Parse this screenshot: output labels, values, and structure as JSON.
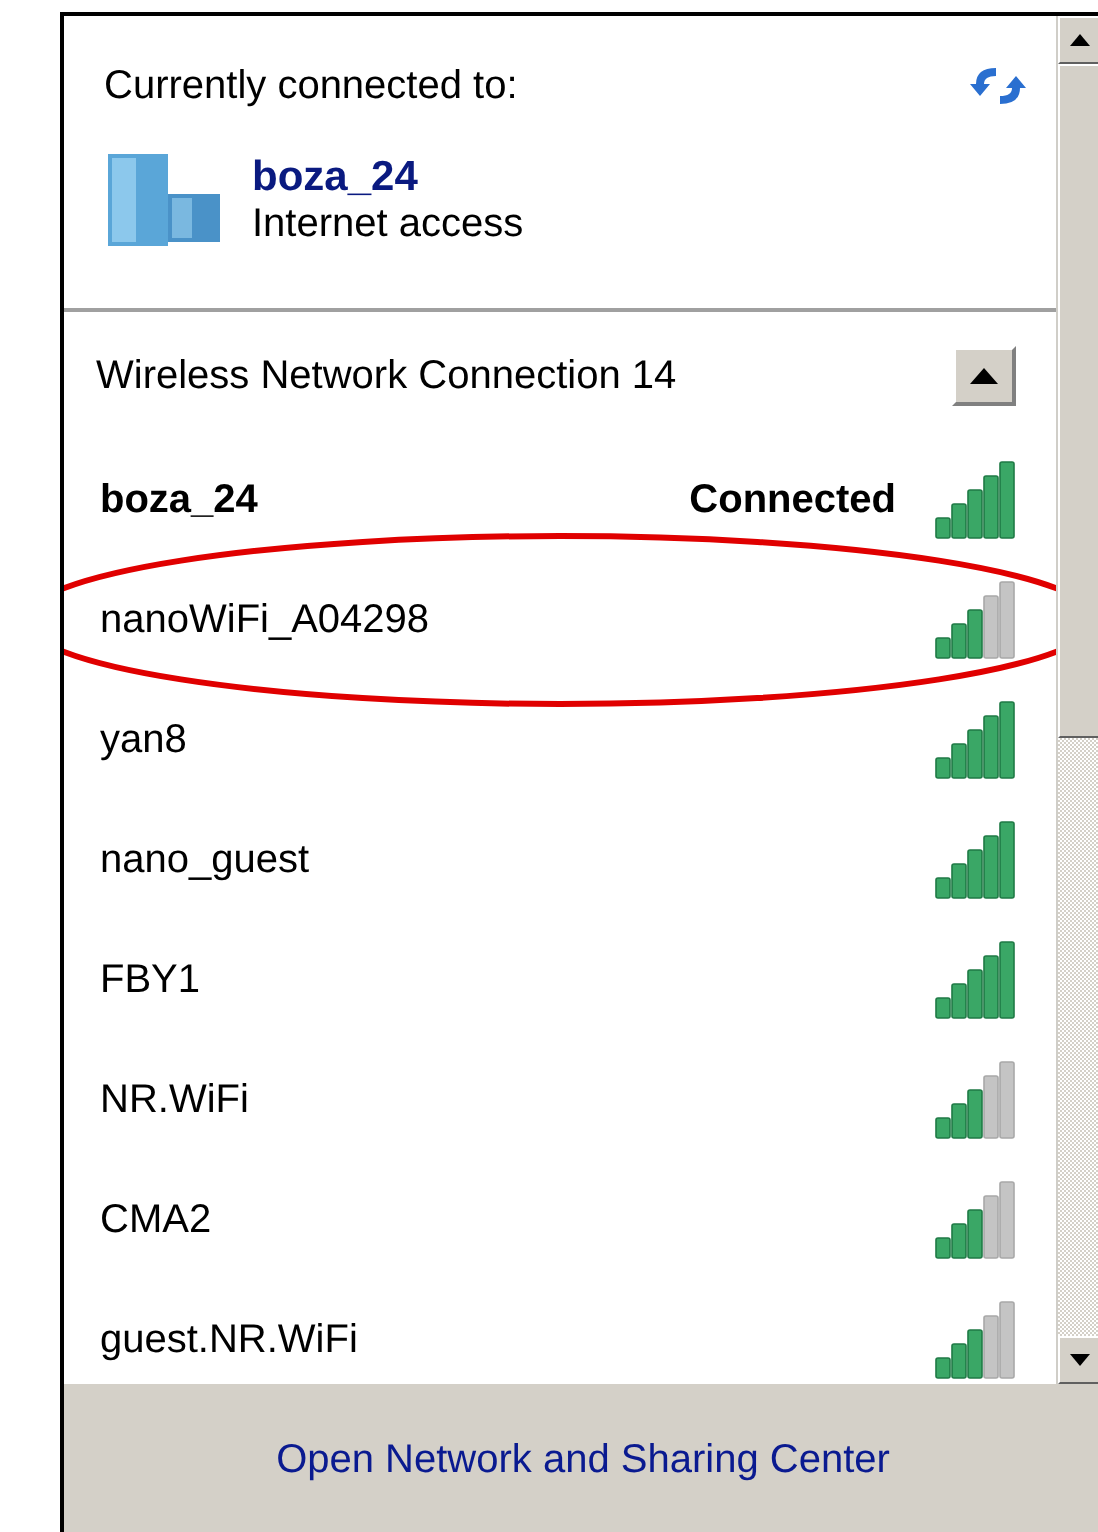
{
  "current": {
    "heading": "Currently connected to:",
    "network": "boza_24",
    "status": "Internet access"
  },
  "section": {
    "title": "Wireless Network Connection 14",
    "expanded": true
  },
  "networks": [
    {
      "name": "boza_24",
      "connected": true,
      "status": "Connected",
      "full_signal": true,
      "circled": false
    },
    {
      "name": "nanoWiFi_A04298",
      "connected": false,
      "full_signal": false,
      "circled": true
    },
    {
      "name": "yan8",
      "connected": false,
      "full_signal": true,
      "circled": false
    },
    {
      "name": "nano_guest",
      "connected": false,
      "full_signal": true,
      "circled": false
    },
    {
      "name": "FBY1",
      "connected": false,
      "full_signal": true,
      "circled": false
    },
    {
      "name": "NR.WiFi",
      "connected": false,
      "full_signal": false,
      "circled": false
    },
    {
      "name": "CMA2",
      "connected": false,
      "full_signal": false,
      "circled": false
    },
    {
      "name": "guest.NR.WiFi",
      "connected": false,
      "full_signal": false,
      "circled": false
    }
  ],
  "footer": {
    "link": "Open Network and Sharing Center"
  }
}
